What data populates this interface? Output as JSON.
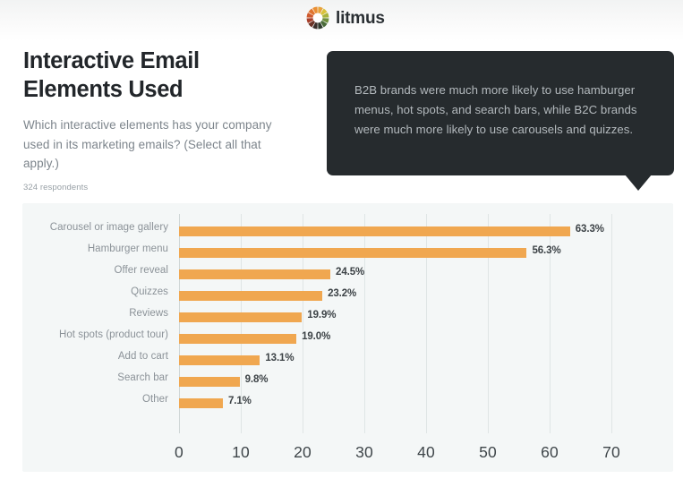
{
  "brand": {
    "name": "litmus",
    "logo_icon": "color-wheel-icon",
    "wheel_colors": [
      "#e8a33d",
      "#d9c23a",
      "#a8b33a",
      "#6f8f3e",
      "#4a6b3a",
      "#2f3b2e",
      "#3a2f2b",
      "#6b3326",
      "#a8402c",
      "#cf5a2e",
      "#e0742f",
      "#ea8f33"
    ]
  },
  "header": {
    "title_line1": "Interactive Email",
    "title_line2": "Elements Used",
    "subtitle": "Which interactive elements has your company used in its marketing emails? (Select all that apply.)",
    "respondents": "324 respondents"
  },
  "callout": {
    "text": "B2B brands were much more likely to use hamburger menus, hot spots, and search bars, while B2C brands were much more likely to use carousels and quizzes.",
    "background_color": "#262B2E",
    "text_color": "#B3B9BD"
  },
  "colors": {
    "bar": "#F0A750",
    "panel": "#F4F7F7",
    "gridline": "#DFE5E5",
    "value_text": "#3C4246",
    "category_text": "#8B9298"
  },
  "chart_data": {
    "type": "bar",
    "orientation": "horizontal",
    "title": "Interactive Email Elements Used",
    "xlabel": "",
    "ylabel": "",
    "xlim": [
      0,
      70
    ],
    "grid": true,
    "legend": "none",
    "xticks": [
      "0",
      "10",
      "20",
      "30",
      "40",
      "50",
      "60",
      "70"
    ],
    "xtick_values": [
      0,
      10,
      20,
      30,
      40,
      50,
      60,
      70
    ],
    "categories": [
      "Carousel or image gallery",
      "Hamburger menu",
      "Offer reveal",
      "Quizzes",
      "Reviews",
      "Hot spots (product tour)",
      "Add to cart",
      "Search bar",
      "Other"
    ],
    "values": [
      63.3,
      56.3,
      24.5,
      23.2,
      19.9,
      19.0,
      13.1,
      9.8,
      7.1
    ],
    "value_labels": [
      "63.3%",
      "56.3%",
      "24.5%",
      "23.2%",
      "19.9%",
      "19.0%",
      "13.1%",
      "9.8%",
      "7.1%"
    ]
  }
}
